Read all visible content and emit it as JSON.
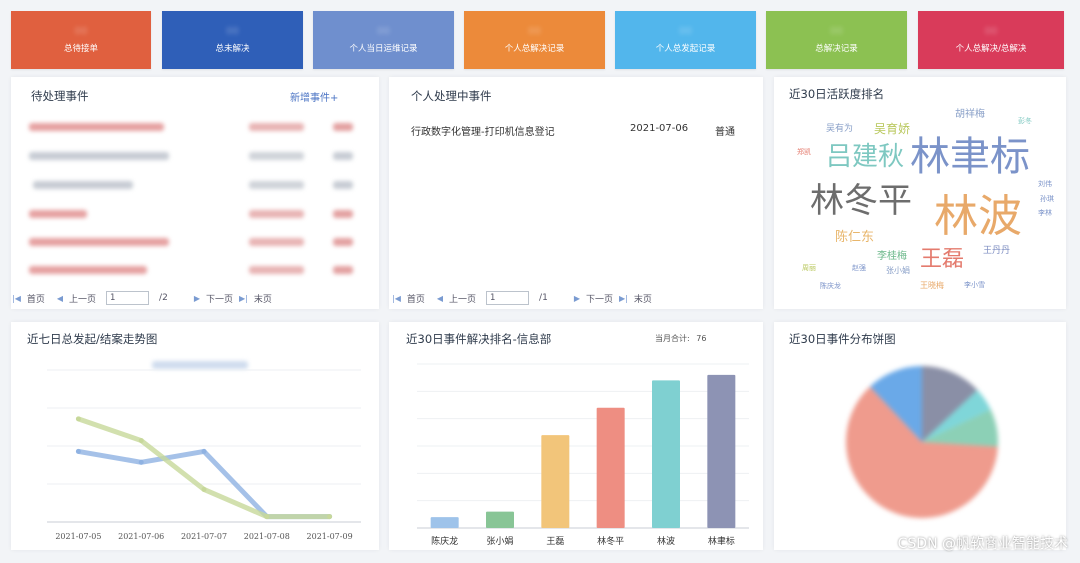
{
  "tiles": [
    {
      "label": "总待接单",
      "color": "#e0603f"
    },
    {
      "label": "总未解决",
      "color": "#2f5fb8"
    },
    {
      "label": "个人当日运维记录",
      "color": "#6f8fce"
    },
    {
      "label": "个人总解决记录",
      "color": "#ec8a3a"
    },
    {
      "label": "个人总发起记录",
      "color": "#52b6ec"
    },
    {
      "label": "总解决记录",
      "color": "#8cc152"
    },
    {
      "label": "个人总解决/总解决",
      "color": "#d93b5a"
    }
  ],
  "pending": {
    "title": "待处理事件",
    "add_label": "新增事件+",
    "pager": {
      "first": "首页",
      "prev": "上一页",
      "page": "1",
      "total": "/2",
      "next": "下一页",
      "last": "末页"
    }
  },
  "inprogress": {
    "title": "个人处理中事件",
    "row": {
      "name": "行政数字化管理-打印机信息登记",
      "date": "2021-07-06",
      "level": "普通"
    },
    "pager": {
      "first": "首页",
      "prev": "上一页",
      "page": "1",
      "total": "/1",
      "next": "下一页",
      "last": "末页"
    }
  },
  "activity": {
    "title": "近30日活跃度排名",
    "words": [
      {
        "text": "林聿标",
        "color": "#7b93c9"
      },
      {
        "text": "林波",
        "color": "#e8a96a"
      },
      {
        "text": "林冬平",
        "color": "#6d6d6d"
      },
      {
        "text": "吕建秋",
        "color": "#7ec8c1"
      },
      {
        "text": "王磊",
        "color": "#e47b6e"
      },
      {
        "text": "陈仁东",
        "color": "#e8b66c"
      },
      {
        "text": "吴育娇",
        "color": "#b8c75b"
      },
      {
        "text": "吴有为",
        "color": "#8aa0c8"
      },
      {
        "text": "胡祥梅",
        "color": "#8aa0c8"
      },
      {
        "text": "李桂梅",
        "color": "#6bb88a"
      },
      {
        "text": "王丹丹",
        "color": "#7b8bc0"
      },
      {
        "text": "张小娟",
        "color": "#8aa0c8"
      },
      {
        "text": "王晓梅",
        "color": "#e8a96a"
      },
      {
        "text": "陈庆龙",
        "color": "#7b93c9"
      },
      {
        "text": "李小雪",
        "color": "#7b93c9"
      },
      {
        "text": "赵强",
        "color": "#7b93c9"
      },
      {
        "text": "刘伟",
        "color": "#7b93c9"
      },
      {
        "text": "孙琪",
        "color": "#7b93c9"
      },
      {
        "text": "李林",
        "color": "#7b93c9"
      },
      {
        "text": "郑凯",
        "color": "#e47b6e"
      },
      {
        "text": "周丽",
        "color": "#b8c75b"
      },
      {
        "text": "彭冬",
        "color": "#7ec8c1"
      }
    ]
  },
  "trend": {
    "title": "近七日总发起/结案走势图",
    "chart_data": {
      "type": "line",
      "categories": [
        "2021-07-05",
        "2021-07-06",
        "2021-07-07",
        "2021-07-08",
        "2021-07-09"
      ],
      "ylim": [
        0,
        28
      ],
      "series": [
        {
          "values": [
            13,
            11,
            13,
            1,
            1
          ],
          "color": "#8fb2e2"
        },
        {
          "values": [
            19,
            15,
            6,
            1,
            1
          ],
          "color": "#c7d89a"
        }
      ]
    }
  },
  "ranking": {
    "title": "近30日事件解决排名-信息部",
    "total_label": "当月合计:",
    "total_value": "76",
    "chart_data": {
      "type": "bar",
      "categories": [
        "陈庆龙",
        "张小娟",
        "王磊",
        "林冬平",
        "林波",
        "林聿标"
      ],
      "values": [
        2,
        3,
        17,
        22,
        27,
        28
      ],
      "colors": [
        "#9ec3ea",
        "#88c596",
        "#f2c57a",
        "#ee8e82",
        "#7fd0d1",
        "#8d93b4"
      ],
      "ylim": [
        0,
        30
      ]
    }
  },
  "distribution": {
    "title": "近30日事件分布饼图",
    "chart_data": {
      "type": "pie",
      "values": [
        62,
        8,
        5,
        12,
        13
      ],
      "colors": [
        "#ef9b8d",
        "#8cd0b6",
        "#7fd6d9",
        "#6aa9e8",
        "#8a8fa6"
      ]
    }
  },
  "watermark": "CSDN @帆软商业智能技术"
}
